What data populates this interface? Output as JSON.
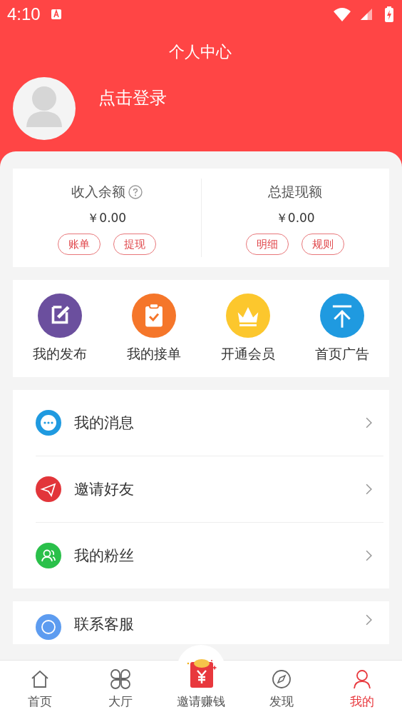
{
  "status_bar": {
    "time": "4:10"
  },
  "header": {
    "title": "个人中心",
    "login": "点击登录"
  },
  "balances": [
    {
      "label": "收入余额",
      "help": true,
      "amount": "￥0.00",
      "actions": [
        "账单",
        "提现"
      ]
    },
    {
      "label": "总提现额",
      "help": false,
      "amount": "￥0.00",
      "actions": [
        "明细",
        "规则"
      ]
    }
  ],
  "shortcuts": [
    {
      "label": "我的发布",
      "kind": "edit",
      "color": "#6b4f9e"
    },
    {
      "label": "我的接单",
      "kind": "clipboard",
      "color": "#f5762a"
    },
    {
      "label": "开通会员",
      "kind": "crown",
      "color": "#fcc72d"
    },
    {
      "label": "首页广告",
      "kind": "top",
      "color": "#1f9ae0"
    }
  ],
  "menu": [
    {
      "label": "我的消息",
      "kind": "message"
    },
    {
      "label": "邀请好友",
      "kind": "plane"
    },
    {
      "label": "我的粉丝",
      "kind": "fans"
    }
  ],
  "menu2": [
    {
      "label": "联系客服",
      "kind": "service"
    }
  ],
  "tabs": [
    {
      "label": "首页",
      "kind": "home",
      "selected": false
    },
    {
      "label": "大厅",
      "kind": "hall",
      "selected": false
    },
    {
      "label": "邀请赚钱",
      "kind": "envelope",
      "selected": false
    },
    {
      "label": "发现",
      "kind": "compass",
      "selected": false
    },
    {
      "label": "我的",
      "kind": "user",
      "selected": true
    }
  ]
}
